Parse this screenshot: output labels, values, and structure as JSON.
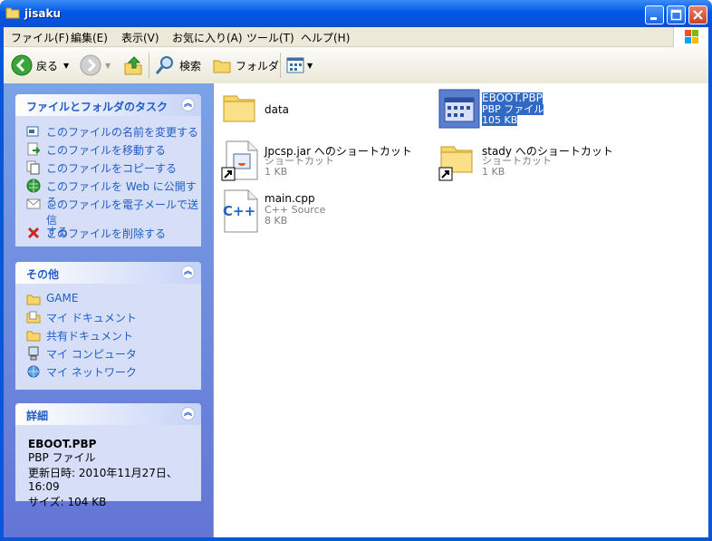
{
  "window": {
    "title": "jisaku"
  },
  "menu": [
    "ファイル(F)",
    "編集(E)",
    "表示(V)",
    "お気に入り(A)",
    "ツール(T)",
    "ヘルプ(H)"
  ],
  "toolbar": {
    "back": "戻る",
    "search": "検索",
    "folders": "フォルダ"
  },
  "tasks": {
    "title": "ファイルとフォルダのタスク",
    "items": [
      "このファイルの名前を変更する",
      "このファイルを移動する",
      "このファイルをコピーする",
      "このファイルを Web に公開する",
      "このファイルを電子メールで送信",
      "する",
      "このファイルを削除する"
    ]
  },
  "other": {
    "title": "その他",
    "items": [
      "GAME",
      "マイ ドキュメント",
      "共有ドキュメント",
      "マイ コンピュータ",
      "マイ ネットワーク"
    ]
  },
  "details": {
    "title": "詳細",
    "name": "EBOOT.PBP",
    "type": "PBP ファイル",
    "modified": "更新日時: 2010年11月27日、16:09",
    "size": "サイズ: 104 KB"
  },
  "files": [
    {
      "name": "data",
      "lines": []
    },
    {
      "name": "EBOOT.PBP",
      "lines": [
        "PBP ファイル",
        "105 KB"
      ]
    },
    {
      "name": "Jpcsp.jar へのショートカット",
      "lines": [
        "ショートカット",
        "1 KB"
      ]
    },
    {
      "name": "stady へのショートカット",
      "lines": [
        "ショートカット",
        "1 KB"
      ]
    },
    {
      "name": "main.cpp",
      "lines": [
        "C++ Source",
        "8 KB"
      ]
    }
  ],
  "cpp_icon_text": "C++"
}
